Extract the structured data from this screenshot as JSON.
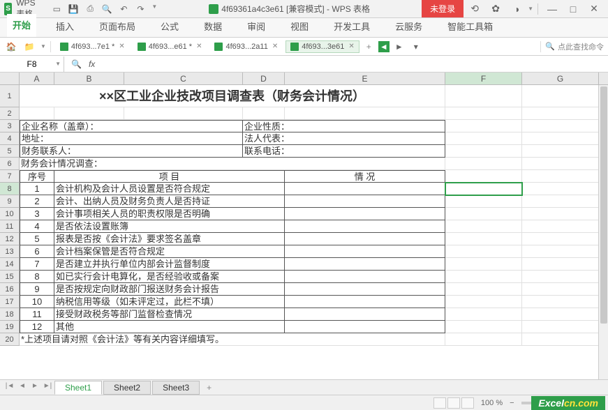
{
  "app": {
    "name": "WPS 表格",
    "doc_title": "4f69361a4c3e61 [兼容模式] - WPS 表格",
    "login": "未登录"
  },
  "ribbon": {
    "tabs": [
      "开始",
      "插入",
      "页面布局",
      "公式",
      "数据",
      "审阅",
      "视图",
      "开发工具",
      "云服务",
      "智能工具箱"
    ],
    "active": 0
  },
  "doc_tabs": {
    "items": [
      {
        "label": "4f693...7e1 *",
        "active": false
      },
      {
        "label": "4f693...e61 *",
        "active": false
      },
      {
        "label": "4f693...2a11",
        "active": false
      },
      {
        "label": "4f693...3e61",
        "active": true
      }
    ],
    "search_placeholder": "点此查找命令"
  },
  "formula": {
    "name_box": "F8",
    "fx": "fx"
  },
  "columns": [
    "A",
    "B",
    "C",
    "D",
    "E",
    "F",
    "G"
  ],
  "sheet": {
    "title": "××区工业企业技改项目调查表（财务会计情况）",
    "r3": {
      "a": "企业名称（盖章）：",
      "d": "企业性质："
    },
    "r4": {
      "a": "地址：",
      "d": "法人代表："
    },
    "r5": {
      "a": "财务联系人：",
      "d": "联系电话："
    },
    "r6": "财务会计情况调查：",
    "header": {
      "a": "序号",
      "b": "项        目",
      "e": "情        况"
    },
    "rows": [
      {
        "n": "1",
        "item": "会计机构及会计人员设置是否符合规定"
      },
      {
        "n": "2",
        "item": "会计、出纳人员及财务负责人是否持证"
      },
      {
        "n": "3",
        "item": "会计事项相关人员的职责权限是否明确"
      },
      {
        "n": "4",
        "item": "是否依法设置账簿"
      },
      {
        "n": "5",
        "item": "报表是否按《会计法》要求签名盖章"
      },
      {
        "n": "6",
        "item": "会计档案保管是否符合规定"
      },
      {
        "n": "7",
        "item": "是否建立并执行单位内部会计监督制度"
      },
      {
        "n": "8",
        "item": "如已实行会计电算化，是否经验收或备案"
      },
      {
        "n": "9",
        "item": "是否按规定向财政部门报送财务会计报告"
      },
      {
        "n": "10",
        "item": "纳税信用等级（如未评定过，此栏不填）"
      },
      {
        "n": "11",
        "item": "接受财政税务等部门监督检查情况"
      },
      {
        "n": "12",
        "item": "其他"
      }
    ],
    "footnote": "*上述项目请对照《会计法》等有关内容详细填写。"
  },
  "sheets": {
    "items": [
      "Sheet1",
      "Sheet2",
      "Sheet3"
    ],
    "active": 0
  },
  "status": {
    "zoom": "100 %"
  },
  "watermark": {
    "a": "Excel",
    "b": "cn.com"
  }
}
